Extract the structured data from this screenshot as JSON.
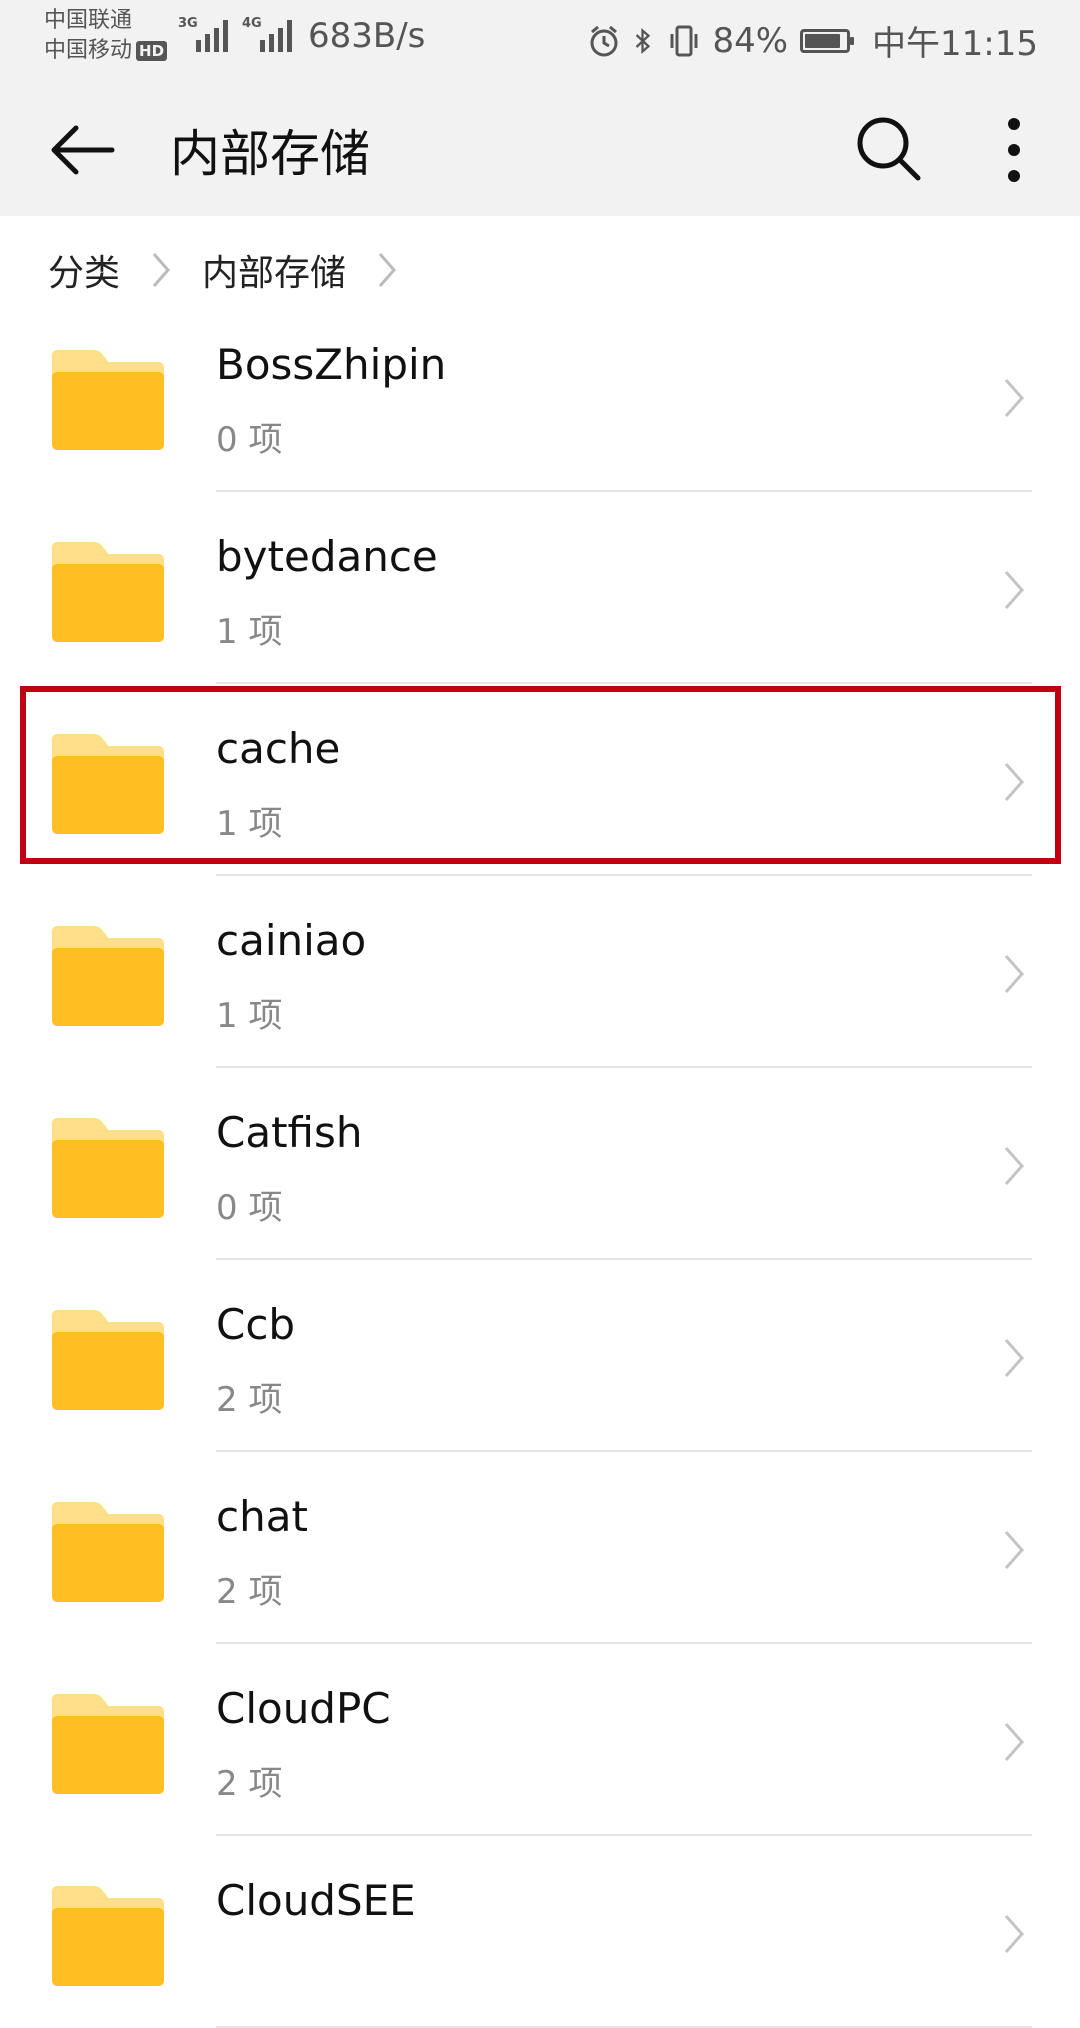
{
  "status_bar": {
    "carrier_1": "中国联通",
    "carrier_2": "中国移动",
    "hd_badge": "HD",
    "signal_1_label": "3G",
    "signal_2_label": "4G",
    "net_speed": "683B/s",
    "battery": "84%",
    "time": "中午11:15"
  },
  "app_bar": {
    "title": "内部存储"
  },
  "breadcrumb": {
    "items": [
      "分类",
      "内部存储"
    ]
  },
  "files": [
    {
      "name": "BossZhipin",
      "count": "0 项"
    },
    {
      "name": "bytedance",
      "count": "1 项"
    },
    {
      "name": "cache",
      "count": "1 项"
    },
    {
      "name": "cainiao",
      "count": "1 项"
    },
    {
      "name": "Catfish",
      "count": "0 项"
    },
    {
      "name": "Ccb",
      "count": "2 项"
    },
    {
      "name": "chat",
      "count": "2 项"
    },
    {
      "name": "CloudPC",
      "count": "2 项"
    },
    {
      "name": "CloudSEE",
      "count": ""
    }
  ],
  "colors": {
    "folder_back": "#FFDE8A",
    "folder_front": "#FFBE21",
    "highlight": "#C00010",
    "bar_bg": "#F2F2F2"
  }
}
